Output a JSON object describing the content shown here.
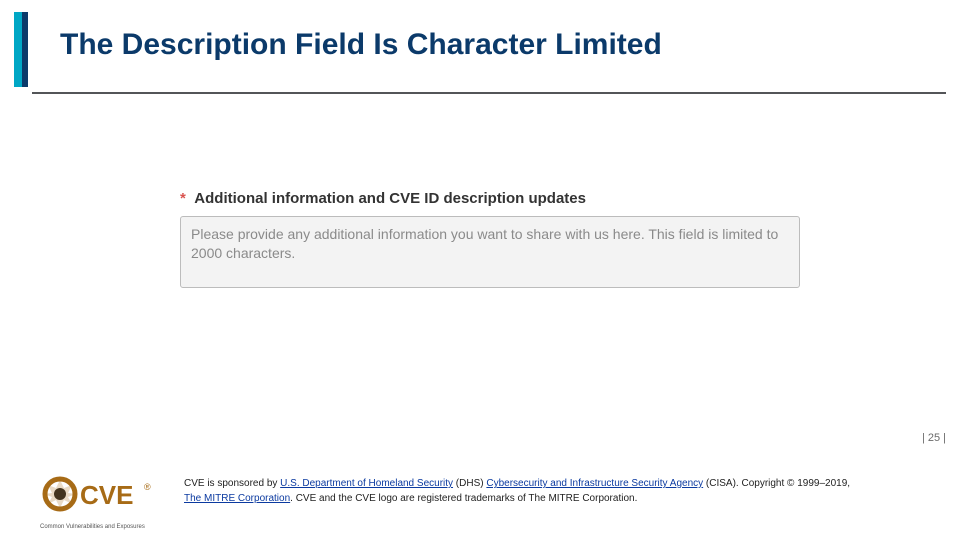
{
  "title": "The Description Field Is Character Limited",
  "form": {
    "required_mark": "*",
    "label": "Additional information and CVE ID description updates",
    "placeholder": "Please provide any additional information you want to share with us here. This field is limited to 2000 characters."
  },
  "page_number": "| 25 |",
  "footer": {
    "logo_text": "CVE",
    "logo_sub": "Common Vulnerabilities and Exposures",
    "pre": "CVE is sponsored by ",
    "link1": "U.S. Department of Homeland Security",
    "mid1": " (DHS) ",
    "link2": "Cybersecurity and Infrastructure Security Agency",
    "mid2": " (CISA). Copyright © 1999–2019, ",
    "link3": "The MITRE Corporation",
    "post": ". CVE and the CVE logo are registered trademarks of The MITRE Corporation."
  }
}
